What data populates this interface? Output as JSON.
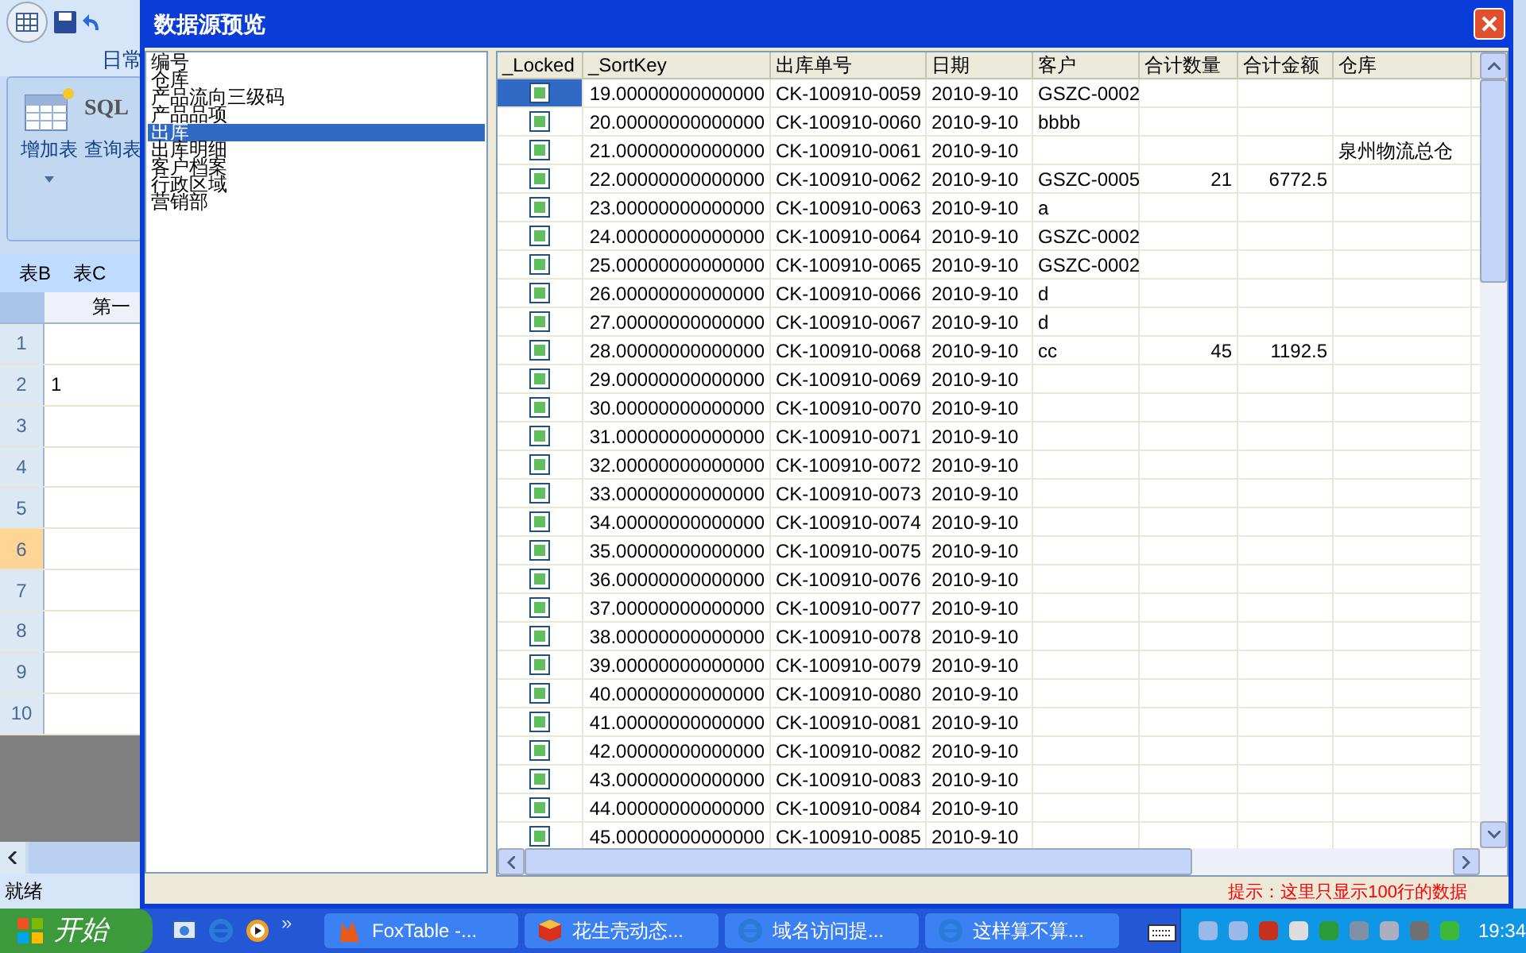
{
  "background_app": {
    "ribbon_tab": "日常",
    "buttons": [
      "增加表",
      "查询表"
    ],
    "sql_label": "SQL",
    "sheet_tabs": [
      "表B",
      "表C"
    ],
    "column_header": "第一",
    "rows": [
      {
        "number": "1",
        "selected": false
      },
      {
        "number": "2",
        "value": "1",
        "selected": false
      },
      {
        "number": "3",
        "selected": false
      },
      {
        "number": "4",
        "selected": false
      },
      {
        "number": "5",
        "selected": false
      },
      {
        "number": "6",
        "selected": true
      },
      {
        "number": "7",
        "selected": false
      },
      {
        "number": "8",
        "selected": false
      },
      {
        "number": "9",
        "selected": false
      },
      {
        "number": "10",
        "selected": false
      }
    ],
    "status": "就绪"
  },
  "dialog": {
    "title": "数据源预览",
    "sources": [
      {
        "label": "编号",
        "selected": false
      },
      {
        "label": "仓库",
        "selected": false
      },
      {
        "label": "产品流向三级码",
        "selected": false
      },
      {
        "label": "产品品项",
        "selected": false
      },
      {
        "label": "出库",
        "selected": true
      },
      {
        "label": "出库明细",
        "selected": false
      },
      {
        "label": "客户档案",
        "selected": false
      },
      {
        "label": "行政区域",
        "selected": false
      },
      {
        "label": "营销部",
        "selected": false
      }
    ],
    "columns": [
      "_Locked",
      "_SortKey",
      "出库单号",
      "日期",
      "客户",
      "合计数量",
      "合计金额",
      "仓库"
    ],
    "rows": [
      {
        "locked": true,
        "selected": true,
        "sort_key": "19.00000000000000",
        "order_no": "CK-100910-0059",
        "date": "2010-9-10",
        "customer": "GSZC-0002"
      },
      {
        "locked": true,
        "selected": false,
        "sort_key": "20.00000000000000",
        "order_no": "CK-100910-0060",
        "date": "2010-9-10",
        "customer": "bbbb"
      },
      {
        "locked": true,
        "selected": false,
        "sort_key": "21.00000000000000",
        "order_no": "CK-100910-0061",
        "date": "2010-9-10",
        "warehouse": "泉州物流总仓"
      },
      {
        "locked": true,
        "selected": false,
        "sort_key": "22.00000000000000",
        "order_no": "CK-100910-0062",
        "date": "2010-9-10",
        "customer": "GSZC-0005",
        "quantity": "21",
        "amount": "6772.5"
      },
      {
        "locked": true,
        "selected": false,
        "sort_key": "23.00000000000000",
        "order_no": "CK-100910-0063",
        "date": "2010-9-10",
        "customer": "a"
      },
      {
        "locked": true,
        "selected": false,
        "sort_key": "24.00000000000000",
        "order_no": "CK-100910-0064",
        "date": "2010-9-10",
        "customer": "GSZC-0002"
      },
      {
        "locked": true,
        "selected": false,
        "sort_key": "25.00000000000000",
        "order_no": "CK-100910-0065",
        "date": "2010-9-10",
        "customer": "GSZC-0002"
      },
      {
        "locked": true,
        "selected": false,
        "sort_key": "26.00000000000000",
        "order_no": "CK-100910-0066",
        "date": "2010-9-10",
        "customer": "d"
      },
      {
        "locked": true,
        "selected": false,
        "sort_key": "27.00000000000000",
        "order_no": "CK-100910-0067",
        "date": "2010-9-10",
        "customer": "d"
      },
      {
        "locked": true,
        "selected": false,
        "sort_key": "28.00000000000000",
        "order_no": "CK-100910-0068",
        "date": "2010-9-10",
        "customer": "cc",
        "quantity": "45",
        "amount": "1192.5"
      },
      {
        "locked": true,
        "selected": false,
        "sort_key": "29.00000000000000",
        "order_no": "CK-100910-0069",
        "date": "2010-9-10"
      },
      {
        "locked": true,
        "selected": false,
        "sort_key": "30.00000000000000",
        "order_no": "CK-100910-0070",
        "date": "2010-9-10"
      },
      {
        "locked": true,
        "selected": false,
        "sort_key": "31.00000000000000",
        "order_no": "CK-100910-0071",
        "date": "2010-9-10"
      },
      {
        "locked": true,
        "selected": false,
        "sort_key": "32.00000000000000",
        "order_no": "CK-100910-0072",
        "date": "2010-9-10"
      },
      {
        "locked": true,
        "selected": false,
        "sort_key": "33.00000000000000",
        "order_no": "CK-100910-0073",
        "date": "2010-9-10"
      },
      {
        "locked": true,
        "selected": false,
        "sort_key": "34.00000000000000",
        "order_no": "CK-100910-0074",
        "date": "2010-9-10"
      },
      {
        "locked": true,
        "selected": false,
        "sort_key": "35.00000000000000",
        "order_no": "CK-100910-0075",
        "date": "2010-9-10"
      },
      {
        "locked": true,
        "selected": false,
        "sort_key": "36.00000000000000",
        "order_no": "CK-100910-0076",
        "date": "2010-9-10"
      },
      {
        "locked": true,
        "selected": false,
        "sort_key": "37.00000000000000",
        "order_no": "CK-100910-0077",
        "date": "2010-9-10"
      },
      {
        "locked": true,
        "selected": false,
        "sort_key": "38.00000000000000",
        "order_no": "CK-100910-0078",
        "date": "2010-9-10"
      },
      {
        "locked": true,
        "selected": false,
        "sort_key": "39.00000000000000",
        "order_no": "CK-100910-0079",
        "date": "2010-9-10"
      },
      {
        "locked": true,
        "selected": false,
        "sort_key": "40.00000000000000",
        "order_no": "CK-100910-0080",
        "date": "2010-9-10"
      },
      {
        "locked": true,
        "selected": false,
        "sort_key": "41.00000000000000",
        "order_no": "CK-100910-0081",
        "date": "2010-9-10"
      },
      {
        "locked": true,
        "selected": false,
        "sort_key": "42.00000000000000",
        "order_no": "CK-100910-0082",
        "date": "2010-9-10"
      },
      {
        "locked": true,
        "selected": false,
        "sort_key": "43.00000000000000",
        "order_no": "CK-100910-0083",
        "date": "2010-9-10"
      },
      {
        "locked": true,
        "selected": false,
        "sort_key": "44.00000000000000",
        "order_no": "CK-100910-0084",
        "date": "2010-9-10"
      },
      {
        "locked": true,
        "selected": false,
        "sort_key": "45.00000000000000",
        "order_no": "CK-100910-0085",
        "date": "2010-9-10"
      }
    ],
    "hint": "提示：这里只显示100行的数据"
  },
  "taskbar": {
    "start": "开始",
    "overflow": "»",
    "tasks": [
      {
        "label": "FoxTable -..."
      },
      {
        "label": "花生壳动态..."
      },
      {
        "label": "域名访问提..."
      },
      {
        "label": "这样算不算..."
      }
    ],
    "clock": "19:34"
  }
}
